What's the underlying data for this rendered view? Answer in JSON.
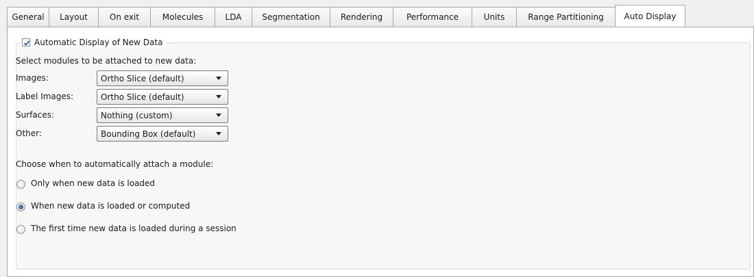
{
  "tabs": [
    {
      "label": "General",
      "active": false
    },
    {
      "label": "Layout",
      "active": false
    },
    {
      "label": "On exit",
      "active": false
    },
    {
      "label": "Molecules",
      "active": false
    },
    {
      "label": "LDA",
      "active": false
    },
    {
      "label": "Segmentation",
      "active": false
    },
    {
      "label": "Rendering",
      "active": false
    },
    {
      "label": "Performance",
      "active": false
    },
    {
      "label": "Units",
      "active": false
    },
    {
      "label": "Range Partitioning",
      "active": false
    },
    {
      "label": "Auto Display",
      "active": true
    }
  ],
  "auto_display": {
    "checkbox_label": "Automatic Display of New Data",
    "checked": true,
    "modules_heading": "Select modules to be attached to new data:",
    "modules": [
      {
        "label": "Images:",
        "value": "Ortho Slice (default)"
      },
      {
        "label": "Label Images:",
        "value": "Ortho Slice (default)"
      },
      {
        "label": "Surfaces:",
        "value": "Nothing (custom)"
      },
      {
        "label": "Other:",
        "value": "Bounding Box (default)"
      }
    ],
    "when_heading": "Choose when to automatically attach a module:",
    "options": [
      {
        "label": "Only when new data is loaded",
        "selected": false
      },
      {
        "label": "When new data is loaded or computed",
        "selected": true
      },
      {
        "label": "The first time new data is loaded during a session",
        "selected": false
      }
    ]
  },
  "colors": {
    "check": "#1e5bb8",
    "radio_selected": "#1f3f7a"
  }
}
